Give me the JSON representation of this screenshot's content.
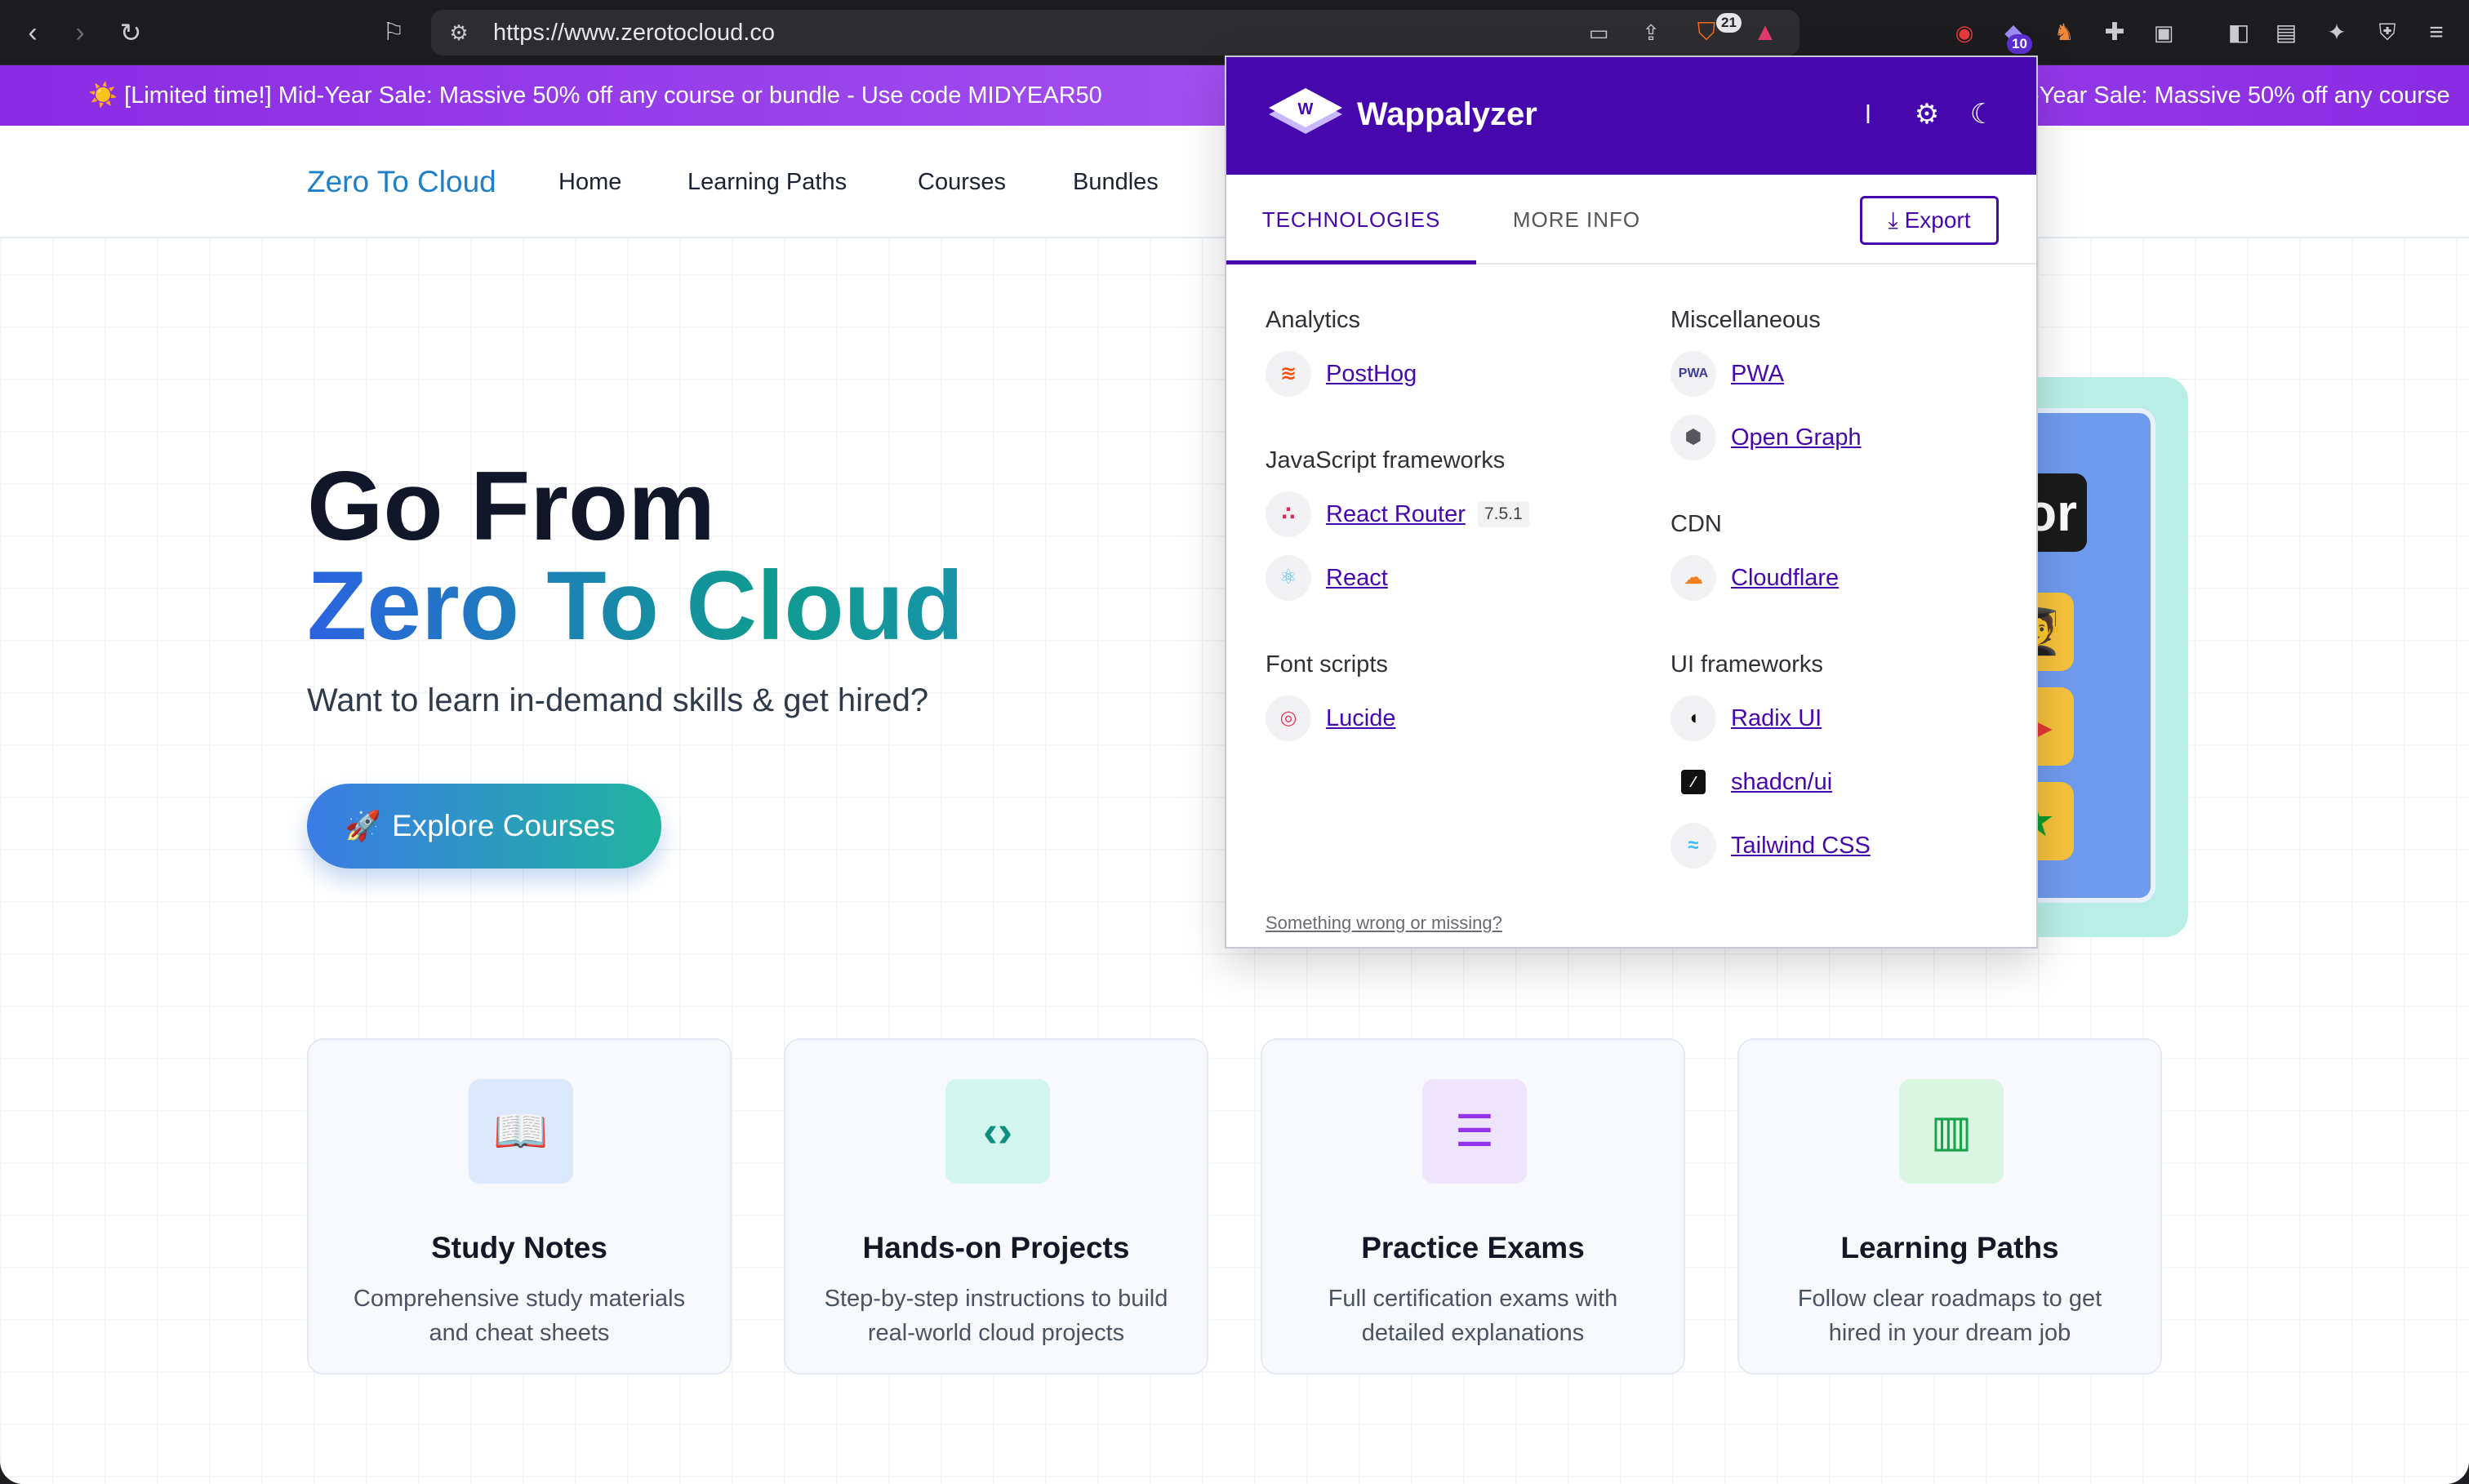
{
  "browser": {
    "url": "https://www.zerotocloud.co",
    "shield_count": "21",
    "wappalyzer_count": "10",
    "icons": [
      "back-icon",
      "forward-icon",
      "reload-icon",
      "bookmark-icon",
      "site-settings-icon",
      "cast-icon",
      "share-icon",
      "brave-shield-icon",
      "brave-rewards-icon",
      "eye-extension-icon",
      "wappalyzer-extension-icon",
      "fox-extension-icon",
      "extensions-icon",
      "tab-search-icon",
      "sidebar-icon",
      "wallet-icon",
      "leo-ai-icon",
      "vpn-icon",
      "menu-icon"
    ]
  },
  "promo": {
    "text": "☀️ [Limited time!] Mid-Year Sale: Massive 50% off any course or bundle - Use code MIDYEAR50",
    "repeat_text": "-Year Sale: Massive 50% off any course"
  },
  "nav": {
    "brand": "Zero To Cloud",
    "links": [
      "Home",
      "Learning Paths",
      "Courses",
      "Bundles"
    ]
  },
  "hero": {
    "title_line1": "Go From",
    "title_line2": "Zero To Cloud",
    "subtitle": "Want to learn in-demand skills & get hired?",
    "cta_label": "Explore Courses",
    "art_tag": "or"
  },
  "features": [
    {
      "title": "Study Notes",
      "desc": "Comprehensive study materials and cheat sheets",
      "icon": "book-icon",
      "icon_color": "#2563eb",
      "bg": "#dce8fc"
    },
    {
      "title": "Hands-on Projects",
      "desc": "Step-by-step instructions to build real-world cloud projects",
      "icon": "code-icon",
      "icon_color": "#0f8f7e",
      "bg": "#d2f5ee"
    },
    {
      "title": "Practice Exams",
      "desc": "Full certification exams with detailed explanations",
      "icon": "file-text-icon",
      "icon_color": "#9333ea",
      "bg": "#efe4fd"
    },
    {
      "title": "Learning Paths",
      "desc": "Follow clear roadmaps to get hired in your dream job",
      "icon": "map-icon",
      "icon_color": "#16a34a",
      "bg": "#daf6e2"
    }
  ],
  "wappalyzer": {
    "name": "Wappalyzer",
    "tabs": [
      "TECHNOLOGIES",
      "MORE INFO"
    ],
    "export_label": "Export",
    "footer": "Something wrong or missing?",
    "left_column": [
      {
        "category": "Analytics",
        "techs": [
          {
            "name": "PostHog",
            "icon": "posthog-icon"
          }
        ]
      },
      {
        "category": "JavaScript frameworks",
        "techs": [
          {
            "name": "React Router",
            "version": "7.5.1",
            "icon": "react-router-icon"
          },
          {
            "name": "React",
            "icon": "react-icon"
          }
        ]
      },
      {
        "category": "Font scripts",
        "techs": [
          {
            "name": "Lucide",
            "icon": "lucide-icon"
          }
        ]
      }
    ],
    "right_column": [
      {
        "category": "Miscellaneous",
        "techs": [
          {
            "name": "PWA",
            "icon": "pwa-icon"
          },
          {
            "name": "Open Graph",
            "icon": "open-graph-icon"
          }
        ]
      },
      {
        "category": "CDN",
        "techs": [
          {
            "name": "Cloudflare",
            "icon": "cloudflare-icon"
          }
        ]
      },
      {
        "category": "UI frameworks",
        "techs": [
          {
            "name": "Radix UI",
            "icon": "radix-ui-icon"
          },
          {
            "name": "shadcn/ui",
            "icon": "shadcn-icon"
          },
          {
            "name": "Tailwind CSS",
            "icon": "tailwind-icon"
          }
        ]
      }
    ]
  }
}
